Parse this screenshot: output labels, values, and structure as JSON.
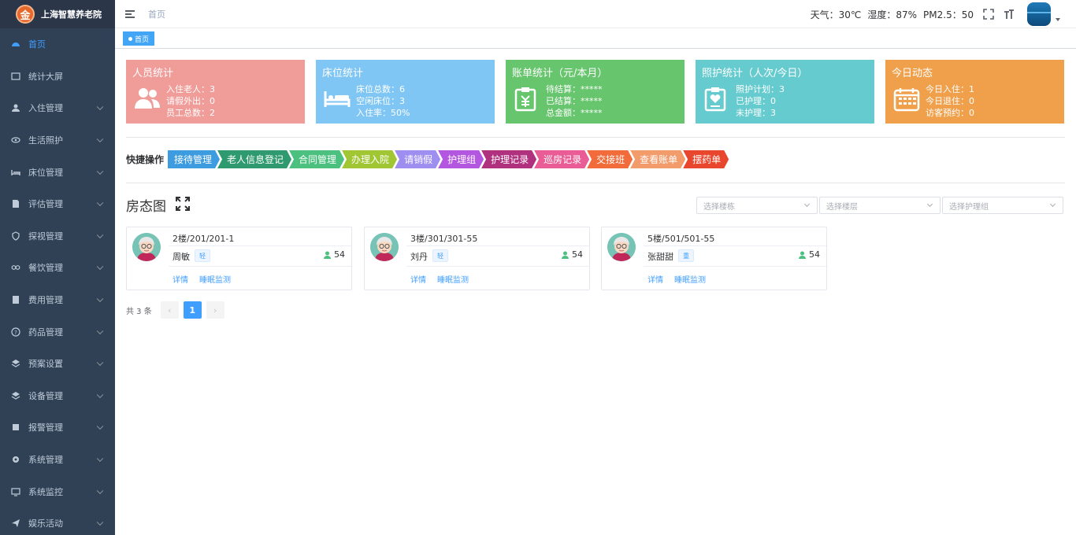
{
  "app": {
    "logo_letter": "金",
    "title": "上海智慧养老院"
  },
  "sidebar": {
    "items": [
      {
        "label": "首页",
        "icon": "dashboard-icon",
        "active": true,
        "has_children": false
      },
      {
        "label": "统计大屏",
        "icon": "screen-icon",
        "active": false,
        "has_children": false
      },
      {
        "label": "入住管理",
        "icon": "user-icon",
        "active": false,
        "has_children": true
      },
      {
        "label": "生活照护",
        "icon": "eye-icon",
        "active": false,
        "has_children": true
      },
      {
        "label": "床位管理",
        "icon": "bed-icon",
        "active": false,
        "has_children": true
      },
      {
        "label": "评估管理",
        "icon": "document-icon",
        "active": false,
        "has_children": true
      },
      {
        "label": "探视管理",
        "icon": "shield-icon",
        "active": false,
        "has_children": true
      },
      {
        "label": "餐饮管理",
        "icon": "link-icon",
        "active": false,
        "has_children": true
      },
      {
        "label": "费用管理",
        "icon": "wallet-icon",
        "active": false,
        "has_children": true
      },
      {
        "label": "药品管理",
        "icon": "question-icon",
        "active": false,
        "has_children": true
      },
      {
        "label": "预案设置",
        "icon": "layers-icon",
        "active": false,
        "has_children": true
      },
      {
        "label": "设备管理",
        "icon": "layers-icon",
        "active": false,
        "has_children": true
      },
      {
        "label": "报警管理",
        "icon": "alarm-icon",
        "active": false,
        "has_children": true
      },
      {
        "label": "系统管理",
        "icon": "gear-icon",
        "active": false,
        "has_children": true
      },
      {
        "label": "系统监控",
        "icon": "monitor-icon",
        "active": false,
        "has_children": true
      },
      {
        "label": "娱乐活动",
        "icon": "send-icon",
        "active": false,
        "has_children": true
      }
    ]
  },
  "header": {
    "breadcrumb": "首页",
    "weather": "天气：30℃",
    "humidity": "湿度：87%",
    "pm25": "PM2.5：50"
  },
  "tabs": [
    {
      "label": "首页",
      "active": true
    }
  ],
  "stats": [
    {
      "title": "人员统计",
      "color": "#f09c99",
      "icon": "people-icon",
      "lines": [
        "入住老人：3",
        "请假外出：0",
        "员工总数：2"
      ]
    },
    {
      "title": "床位统计",
      "color": "#7fc6f5",
      "icon": "bed-icon",
      "lines": [
        "床位总数：6",
        "空闲床位：3",
        "入住率：50%"
      ]
    },
    {
      "title": "账单统计（元/本月）",
      "color": "#67c56d",
      "icon": "bill-icon",
      "lines": [
        "待结算：*****",
        "已结算：*****",
        "总金额：*****"
      ]
    },
    {
      "title": "照护统计（人次/今日）",
      "color": "#66cbcf",
      "icon": "clipboard-icon",
      "lines": [
        "照护计划：3",
        "已护理：0",
        "未护理：3"
      ]
    },
    {
      "title": "今日动态",
      "color": "#f0a04b",
      "icon": "calendar-icon",
      "lines": [
        "今日入住：1",
        "今日退住：0",
        "访客预约：0"
      ]
    }
  ],
  "quick_ops": {
    "label": "快捷操作",
    "items": [
      {
        "label": "接待管理",
        "color": "#3d9be0"
      },
      {
        "label": "老人信息登记",
        "color": "#2f9a6f"
      },
      {
        "label": "合同管理",
        "color": "#4cc07f"
      },
      {
        "label": "办理入院",
        "color": "#a0c733"
      },
      {
        "label": "请销假",
        "color": "#9d8ef0"
      },
      {
        "label": "护理组",
        "color": "#b356e0"
      },
      {
        "label": "护理记录",
        "color": "#b0327f"
      },
      {
        "label": "巡房记录",
        "color": "#ea5c95"
      },
      {
        "label": "交接班",
        "color": "#f26b3a"
      },
      {
        "label": "查看账单",
        "color": "#f29b6b"
      },
      {
        "label": "摆药单",
        "color": "#e8472e"
      }
    ]
  },
  "room_map": {
    "title": "房态图",
    "filters": [
      {
        "placeholder": "选择楼栋"
      },
      {
        "placeholder": "选择楼层"
      },
      {
        "placeholder": "选择护理组"
      }
    ],
    "cards": [
      {
        "location": "2楼/201/201-1",
        "name": "周敏",
        "level": "轻",
        "age": "54",
        "link1": "详情",
        "link2": "睡眠监测"
      },
      {
        "location": "3楼/301/301-55",
        "name": "刘丹",
        "level": "轻",
        "age": "54",
        "link1": "详情",
        "link2": "睡眠监测"
      },
      {
        "location": "5楼/501/501-55",
        "name": "张甜甜",
        "level": "重",
        "age": "54",
        "link1": "详情",
        "link2": "睡眠监测"
      }
    ]
  },
  "pagination": {
    "total": "共 3 条",
    "current": "1",
    "prev": "‹",
    "next": "›"
  }
}
